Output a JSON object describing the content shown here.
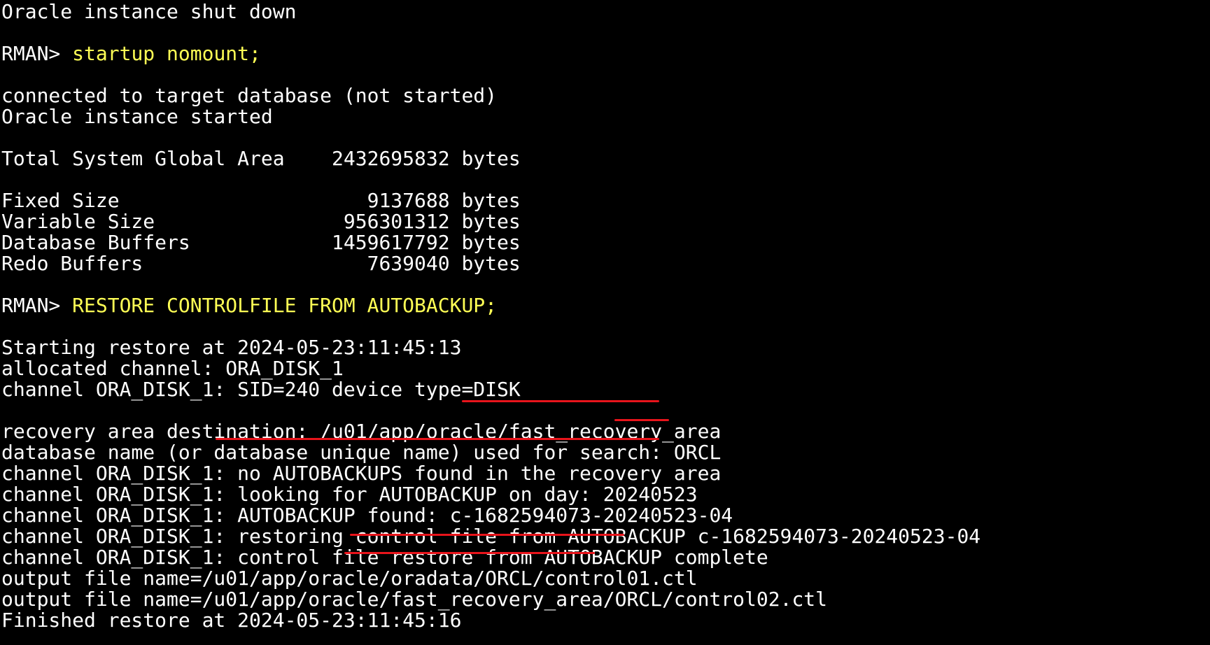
{
  "terminal": {
    "lines": [
      "Oracle instance shut down",
      "",
      {
        "prompt": "RMAN> ",
        "command": "startup nomount;"
      },
      "",
      "connected to target database (not started)",
      "Oracle instance started",
      "",
      "Total System Global Area    2432695832 bytes",
      "",
      "Fixed Size                     9137688 bytes",
      "Variable Size                956301312 bytes",
      "Database Buffers            1459617792 bytes",
      "Redo Buffers                   7639040 bytes",
      "",
      {
        "prompt": "RMAN> ",
        "command": "RESTORE CONTROLFILE FROM AUTOBACKUP;"
      },
      "",
      "Starting restore at 2024-05-23:11:45:13",
      "allocated channel: ORA_DISK_1",
      "channel ORA_DISK_1: SID=240 device type=DISK",
      "",
      "recovery area destination: /u01/app/oracle/fast_recovery_area",
      "database name (or database unique name) used for search: ORCL",
      "channel ORA_DISK_1: no AUTOBACKUPS found in the recovery area",
      "channel ORA_DISK_1: looking for AUTOBACKUP on day: 20240523",
      "channel ORA_DISK_1: AUTOBACKUP found: c-1682594073-20240523-04",
      "channel ORA_DISK_1: restoring control file from AUTOBACKUP c-1682594073-20240523-04",
      "channel ORA_DISK_1: control file restore from AUTOBACKUP complete",
      "output file name=/u01/app/oracle/oradata/ORCL/control01.ctl",
      "output file name=/u01/app/oracle/fast_recovery_area/ORCL/control02.ctl",
      "Finished restore at 2024-05-23:11:45:16"
    ]
  },
  "colors": {
    "background": "#000000",
    "text": "#ffffff",
    "command": "#ffff55",
    "annotation": "#e8141b"
  }
}
